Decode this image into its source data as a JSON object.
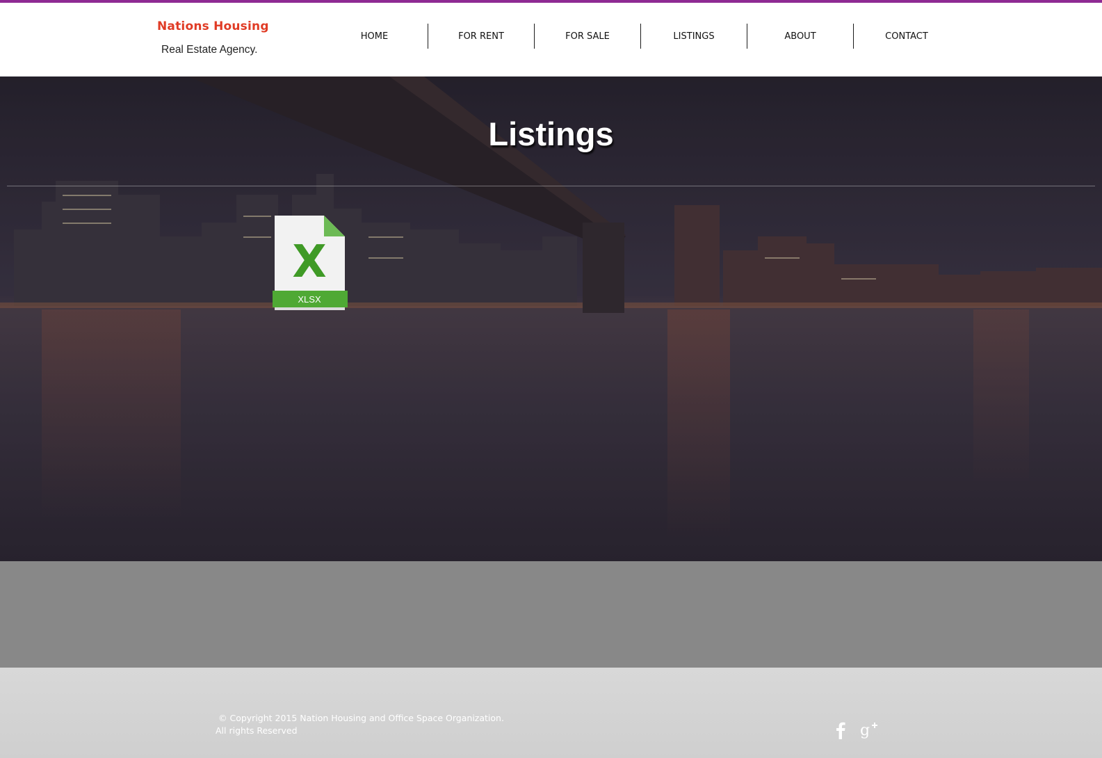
{
  "header": {
    "brand_name": "Nations Housing",
    "brand_tagline": "Real Estate Agency.",
    "accent_color": "#8e2a93",
    "brand_color": "#e03b25"
  },
  "nav": {
    "items": [
      {
        "label": "HOME"
      },
      {
        "label": "FOR RENT"
      },
      {
        "label": "FOR SALE"
      },
      {
        "label": "LISTINGS"
      },
      {
        "label": "ABOUT"
      },
      {
        "label": "CONTACT"
      }
    ]
  },
  "hero": {
    "title": "Listings",
    "background": "night-city-bridge-image",
    "file": {
      "icon": "xlsx-file-icon",
      "type_label": "XLSX",
      "glyph": "X",
      "color": "#3fa02a"
    }
  },
  "footer": {
    "copyright_line1": "© Copyright 2015 Nation Housing and Office Space Organization.",
    "copyright_line2": "All rights Reserved",
    "social": [
      {
        "icon": "facebook-icon",
        "glyph": "f"
      },
      {
        "icon": "google-plus-icon",
        "glyph": "g+"
      }
    ]
  }
}
